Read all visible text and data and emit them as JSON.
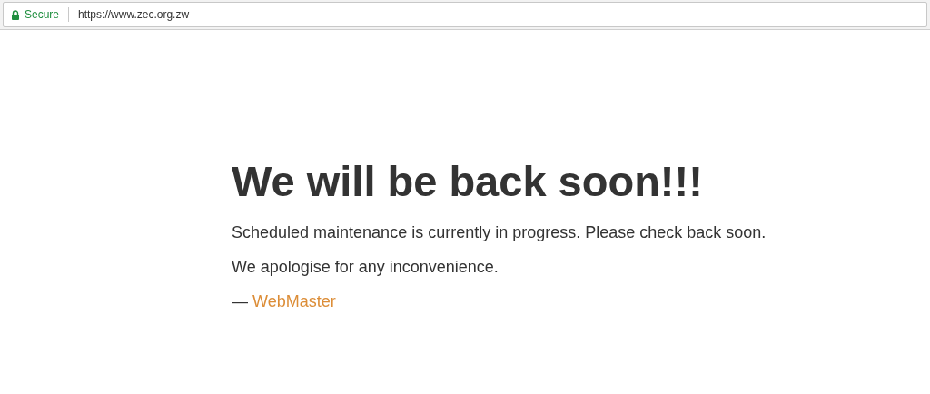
{
  "address_bar": {
    "security_label": "Secure",
    "url": "https://www.zec.org.zw"
  },
  "page": {
    "heading": "We will be back soon!!!",
    "paragraphs": [
      "Scheduled maintenance is currently in progress. Please check back soon.",
      "We apologise for any inconvenience."
    ],
    "signature": {
      "dash": "—",
      "link": "WebMaster"
    }
  }
}
